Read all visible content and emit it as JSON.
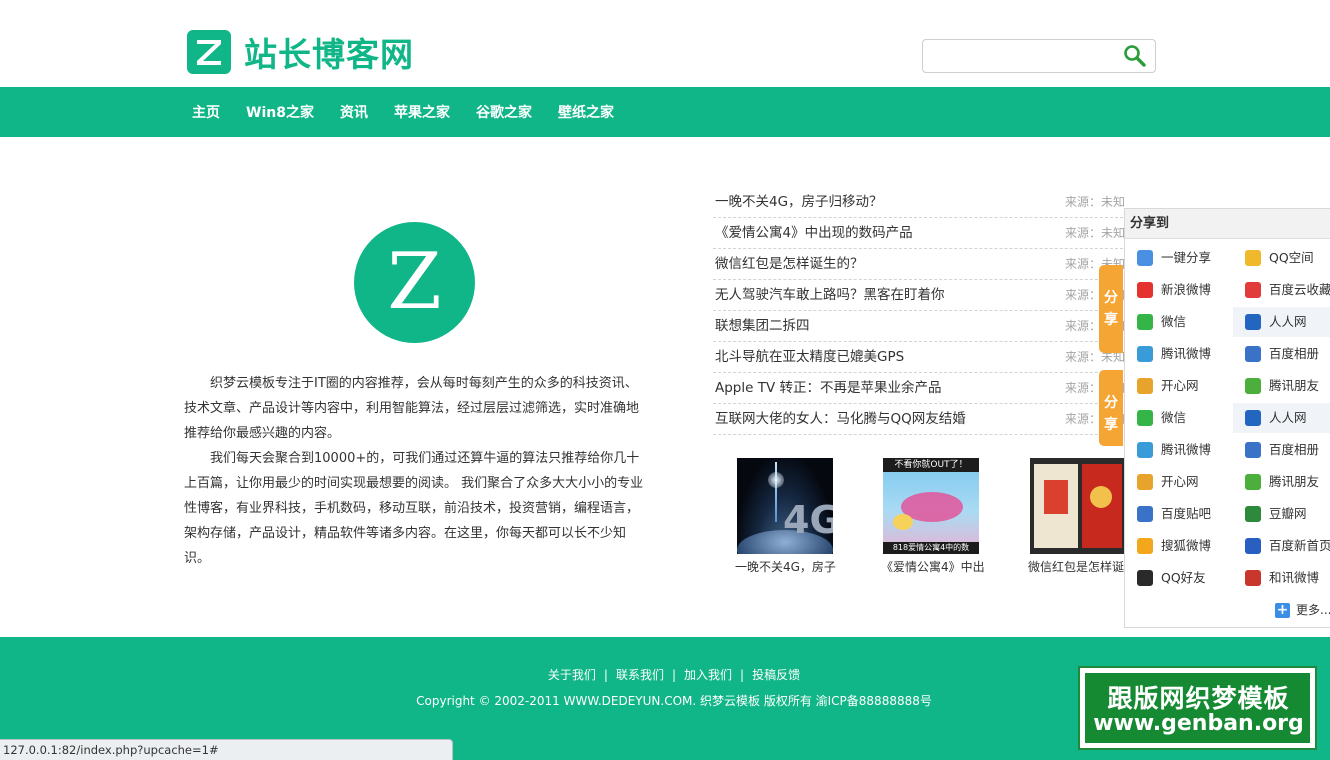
{
  "header": {
    "logo_letter": "Z",
    "site_title": "站长博客网",
    "search_placeholder": ""
  },
  "nav": {
    "items": [
      "主页",
      "Win8之家",
      "资讯",
      "苹果之家",
      "谷歌之家",
      "壁纸之家"
    ]
  },
  "about": {
    "logo_letter": "Z",
    "paragraph1": "织梦云模板专注于IT圈的内容推荐，会从每时每刻产生的众多的科技资讯、技术文章、产品设计等内容中，利用智能算法，经过层层过滤筛选，实时准确地推荐给你最感兴趣的内容。",
    "paragraph2": "我们每天会聚合到10000+的，可我们通过还算牛逼的算法只推荐给你几十上百篇，让你用最少的时间实现最想要的阅读。 我们聚合了众多大大小小的专业性博客，有业界科技，手机数码，移动互联，前沿技术，投资营销，编程语言，架构存储，产品设计，精品软件等诸多内容。在这里，你每天都可以长不少知识。"
  },
  "news": {
    "items": [
      {
        "title": "一晚不关4G，房子归移动？",
        "source": "来源：未知"
      },
      {
        "title": "《爱情公寓4》中出现的数码产品",
        "source": "来源：未知"
      },
      {
        "title": "微信红包是怎样诞生的？",
        "source": "来源：未知"
      },
      {
        "title": "无人驾驶汽车敢上路吗？黑客在盯着你",
        "source": "来源：未知"
      },
      {
        "title": "联想集团二拆四",
        "source": "来源：未知"
      },
      {
        "title": "北斗导航在亚太精度已媲美GPS",
        "source": "来源：未知"
      },
      {
        "title": "Apple TV 转正：不再是苹果业余产品",
        "source": "来源：未知"
      },
      {
        "title": "互联网大佬的女人：马化腾与QQ网友结婚",
        "source": "来源：未知"
      }
    ]
  },
  "thumbs": {
    "items": [
      {
        "caption": "一晚不关4G，房子",
        "image_text": "4G"
      },
      {
        "caption": "《爱情公寓4》中出",
        "image_text": "不看你就OUT了！",
        "image_text2": "818爱情公寓4中的数"
      },
      {
        "caption": "微信红包是怎样诞"
      }
    ]
  },
  "share_tabs": {
    "tab1": "分享",
    "tab2": "分享"
  },
  "share": {
    "header": "分享到",
    "items": [
      {
        "label": "一键分享",
        "icon": "one-click-share-icon",
        "color": "#4a90e2"
      },
      {
        "label": "QQ空间",
        "icon": "qzone-icon",
        "color": "#f0b92b"
      },
      {
        "label": "新浪微博",
        "icon": "sina-weibo-icon",
        "color": "#e6322e"
      },
      {
        "label": "百度云收藏",
        "icon": "baidu-heart-icon",
        "color": "#e23b3b"
      },
      {
        "label": "微信",
        "icon": "wechat-icon",
        "color": "#35b447"
      },
      {
        "label": "人人网",
        "icon": "renren-icon",
        "color": "#2266c0"
      },
      {
        "label": "腾讯微博",
        "icon": "tencent-weibo-icon",
        "color": "#3a9bd9"
      },
      {
        "label": "百度相册",
        "icon": "baidu-album-icon",
        "color": "#3a72c8"
      },
      {
        "label": "开心网",
        "icon": "kaixin-icon",
        "color": "#e8a32c"
      },
      {
        "label": "腾讯朋友",
        "icon": "tencent-friend-icon",
        "color": "#4cae3b"
      },
      {
        "label": "微信",
        "icon": "wechat-icon",
        "color": "#35b447"
      },
      {
        "label": "人人网",
        "icon": "renren-icon",
        "color": "#2266c0"
      },
      {
        "label": "腾讯微博",
        "icon": "tencent-weibo-icon",
        "color": "#3a9bd9"
      },
      {
        "label": "百度相册",
        "icon": "baidu-album-icon",
        "color": "#3a72c8"
      },
      {
        "label": "开心网",
        "icon": "kaixin-icon",
        "color": "#e8a32c"
      },
      {
        "label": "腾讯朋友",
        "icon": "tencent-friend-icon",
        "color": "#4cae3b"
      },
      {
        "label": "百度贴吧",
        "icon": "baidu-tieba-icon",
        "color": "#3a72c8"
      },
      {
        "label": "豆瓣网",
        "icon": "douban-icon",
        "color": "#2d8a3a"
      },
      {
        "label": "搜狐微博",
        "icon": "sohu-weibo-icon",
        "color": "#f2a71c"
      },
      {
        "label": "百度新首页",
        "icon": "baidu-home-icon",
        "color": "#2a5fc2"
      },
      {
        "label": "QQ好友",
        "icon": "qq-friend-icon",
        "color": "#2a2a2a"
      },
      {
        "label": "和讯微博",
        "icon": "hexun-weibo-icon",
        "color": "#c9362b"
      }
    ],
    "more_label": "更多..."
  },
  "footer": {
    "links": [
      "关于我们",
      "联系我们",
      "加入我们",
      "投稿反馈"
    ],
    "separator": "|",
    "copyright": "Copyright © 2002-2011 WWW.DEDEYUN.COM. 织梦云模板 版权所有  渝ICP备88888888号"
  },
  "watermark": {
    "line1": "跟版网织梦模板",
    "line2": "www.genban.org"
  },
  "statusbar": {
    "url": "127.0.0.1:82/index.php?upcache=1#"
  },
  "colors": {
    "brand": "#10b687",
    "share_tab": "#f5a534",
    "watermark": "#168a32"
  }
}
